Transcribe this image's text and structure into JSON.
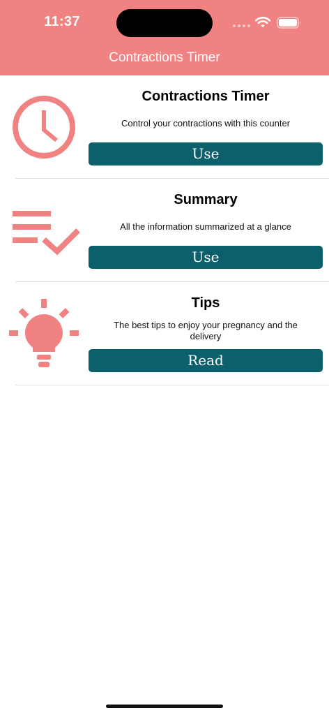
{
  "status_bar": {
    "time": "11:37"
  },
  "nav": {
    "title": "Contractions Timer"
  },
  "rows": [
    {
      "title": "Contractions Timer",
      "description": "Control your contractions with this counter",
      "button": "Use",
      "icon": "clock-icon"
    },
    {
      "title": "Summary",
      "description": "All the information summarized at a glance",
      "button": "Use",
      "icon": "checklist-icon"
    },
    {
      "title": "Tips",
      "description": "The best tips to enjoy your pregnancy and the delivery",
      "button": "Read",
      "icon": "lightbulb-icon"
    }
  ],
  "colors": {
    "accent": "#f08282",
    "button": "#0b606c",
    "text": "#000000",
    "divider": "#e2e2e2"
  }
}
